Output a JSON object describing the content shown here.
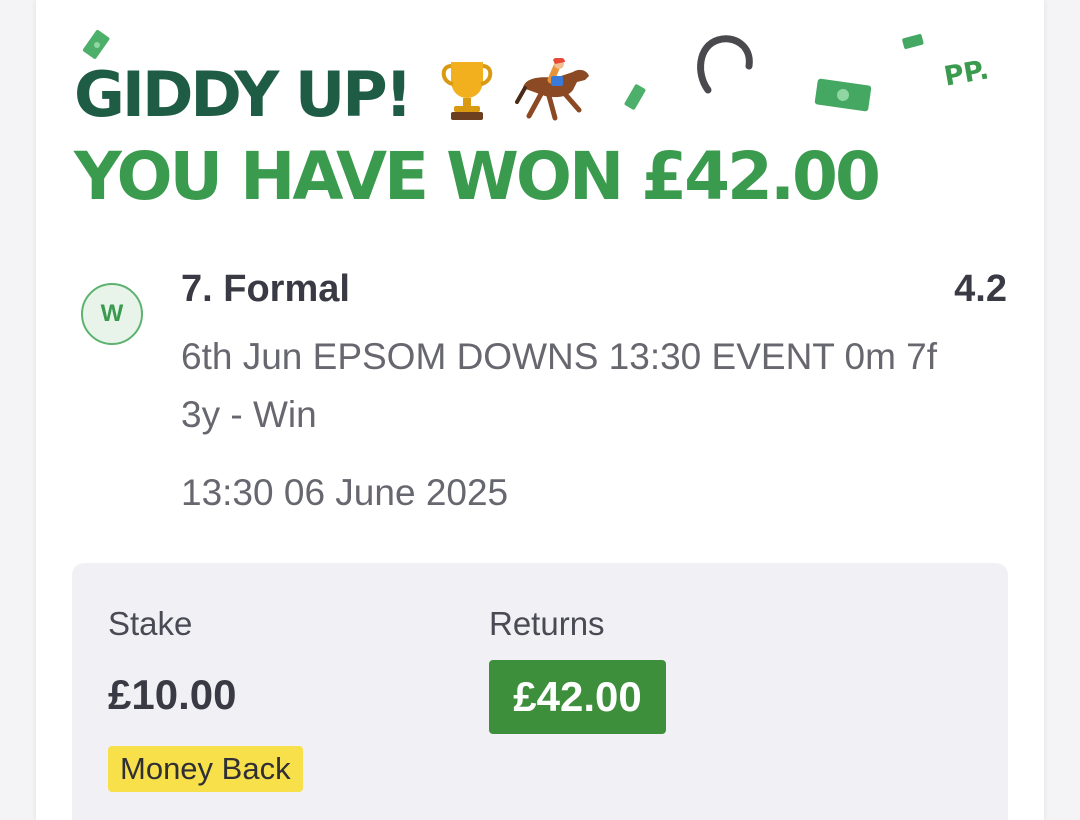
{
  "header": {
    "line1": "GIDDY UP!",
    "line2": "YOU HAVE WON £42.00",
    "emoji_icons": [
      "trophy-icon",
      "horse-racing-icon"
    ],
    "deco_text": "PP."
  },
  "bet": {
    "result_badge": "W",
    "selection": "7. Formal",
    "odds": "4.2",
    "market": "6th Jun EPSOM DOWNS 13:30 EVENT 0m 7f 3y - Win",
    "datetime": "13:30 06 June 2025"
  },
  "summary": {
    "stake_label": "Stake",
    "stake_value": "£10.00",
    "returns_label": "Returns",
    "returns_value": "£42.00",
    "promo_tag": "Money Back"
  },
  "colors": {
    "headline_dark": "#1f5c45",
    "headline_green": "#3a9a4e",
    "returns_bg": "#3d8f3c",
    "promo_bg": "#f7e04a"
  }
}
